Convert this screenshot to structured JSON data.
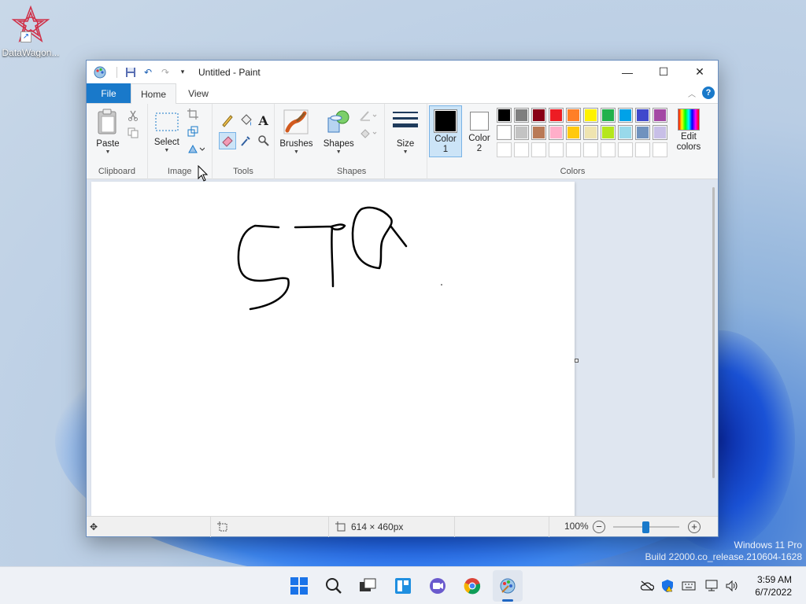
{
  "desktop": {
    "icon_label": "DataWagon...",
    "watermark_line1": "Windows 11 Pro",
    "watermark_line2": "Build 22000.co_release.210604-1628"
  },
  "window": {
    "title": "Untitled - Paint",
    "controls": {
      "minimize": "—",
      "maximize": "☐",
      "close": "✕"
    }
  },
  "tabs": {
    "file": "File",
    "home": "Home",
    "view": "View"
  },
  "ribbon": {
    "clipboard": {
      "paste": "Paste",
      "group": "Clipboard"
    },
    "image": {
      "select": "Select",
      "group": "Image"
    },
    "tools": {
      "group": "Tools"
    },
    "brushes": {
      "label": "Brushes"
    },
    "shapes": {
      "label": "Shapes",
      "group": "Shapes"
    },
    "size": {
      "label": "Size"
    },
    "color1": {
      "line1": "Color",
      "line2": "1"
    },
    "color2": {
      "line1": "Color",
      "line2": "2"
    },
    "edit_colors": {
      "line1": "Edit",
      "line2": "colors"
    },
    "colors_group": "Colors",
    "palette_row1": [
      "#000000",
      "#7f7f7f",
      "#880015",
      "#ed1c24",
      "#ff7f27",
      "#fff200",
      "#22b14c",
      "#00a2e8",
      "#3f48cc",
      "#a349a4"
    ],
    "palette_row2": [
      "#ffffff",
      "#c3c3c3",
      "#b97a57",
      "#ffaec9",
      "#ffc90e",
      "#efe4b0",
      "#b5e61d",
      "#99d9ea",
      "#7092be",
      "#c8bfe7"
    ],
    "color1_value": "#000000",
    "color2_value": "#ffffff"
  },
  "statusbar": {
    "image_size": "614 × 460px",
    "zoom": "100%"
  },
  "taskbar": {
    "time": "3:59 AM",
    "date": "6/7/2022"
  }
}
